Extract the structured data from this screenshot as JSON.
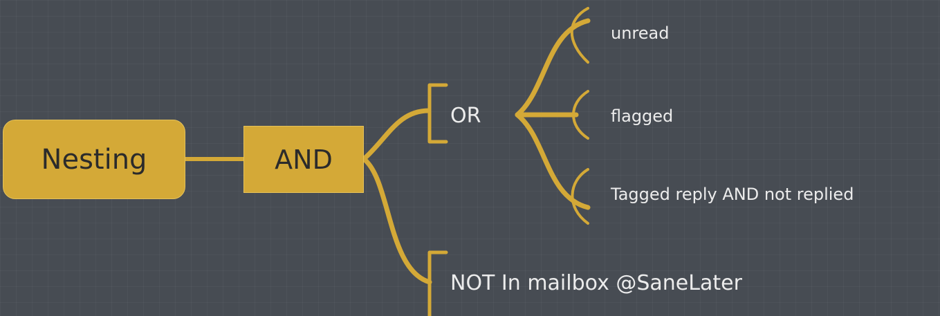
{
  "diagram": {
    "root": {
      "label": "Nesting"
    },
    "and_node": {
      "label": "AND"
    },
    "or_node": {
      "label": "OR"
    },
    "or_children": [
      {
        "label": "unread"
      },
      {
        "label": "flagged"
      },
      {
        "label": "Tagged reply AND not replied"
      }
    ],
    "not_node": {
      "label": "NOT In mailbox @SaneLater"
    }
  },
  "colors": {
    "background": "#474c53",
    "node_fill": "#d4a937",
    "connector": "#d4a937",
    "label_text": "#ececec",
    "node_text": "#2b2b2b"
  }
}
